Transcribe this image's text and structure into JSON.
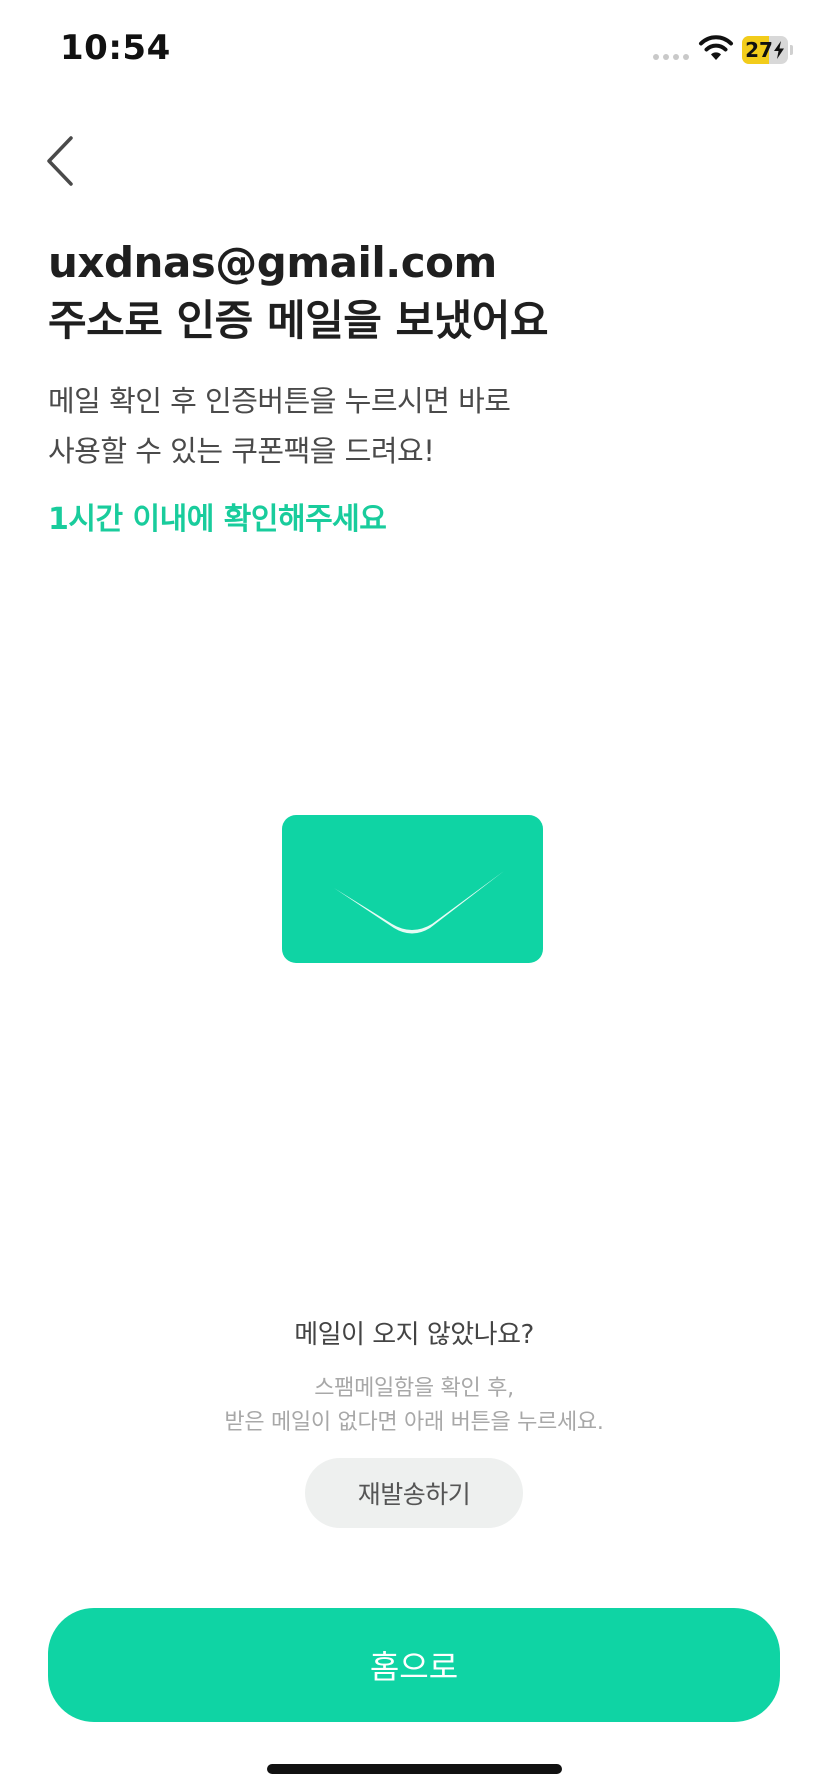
{
  "status_bar": {
    "time": "10:54",
    "battery_level": "27",
    "battery_fraction": 0.27,
    "battery_color": "#f2cc1a",
    "icons": [
      "cellular-signal-icon",
      "wifi-icon",
      "battery-charging-icon"
    ]
  },
  "nav": {
    "back_icon": "chevron-left-icon"
  },
  "header": {
    "email": "uxdnas@gmail.com",
    "title": "주소로 인증 메일을 보냈어요"
  },
  "description": {
    "line1": "메일 확인 후 인증버튼을 누르시면 바로",
    "line2": "사용할 수 있는 쿠폰팩을 드려요!"
  },
  "notice": "1시간 이내에 확인해주세요",
  "illustration": {
    "icon": "envelope-icon",
    "color": "#0fd4a4"
  },
  "resend": {
    "question": "메일이 오지 않았나요?",
    "help_line1": "스팸메일함을 확인 후,",
    "help_line2": "받은 메일이 없다면 아래 버튼을 누르세요.",
    "button_label": "재발송하기"
  },
  "primary_button": {
    "label": "홈으로",
    "color": "#0fd4a4"
  },
  "accent_color": "#19cc9c"
}
